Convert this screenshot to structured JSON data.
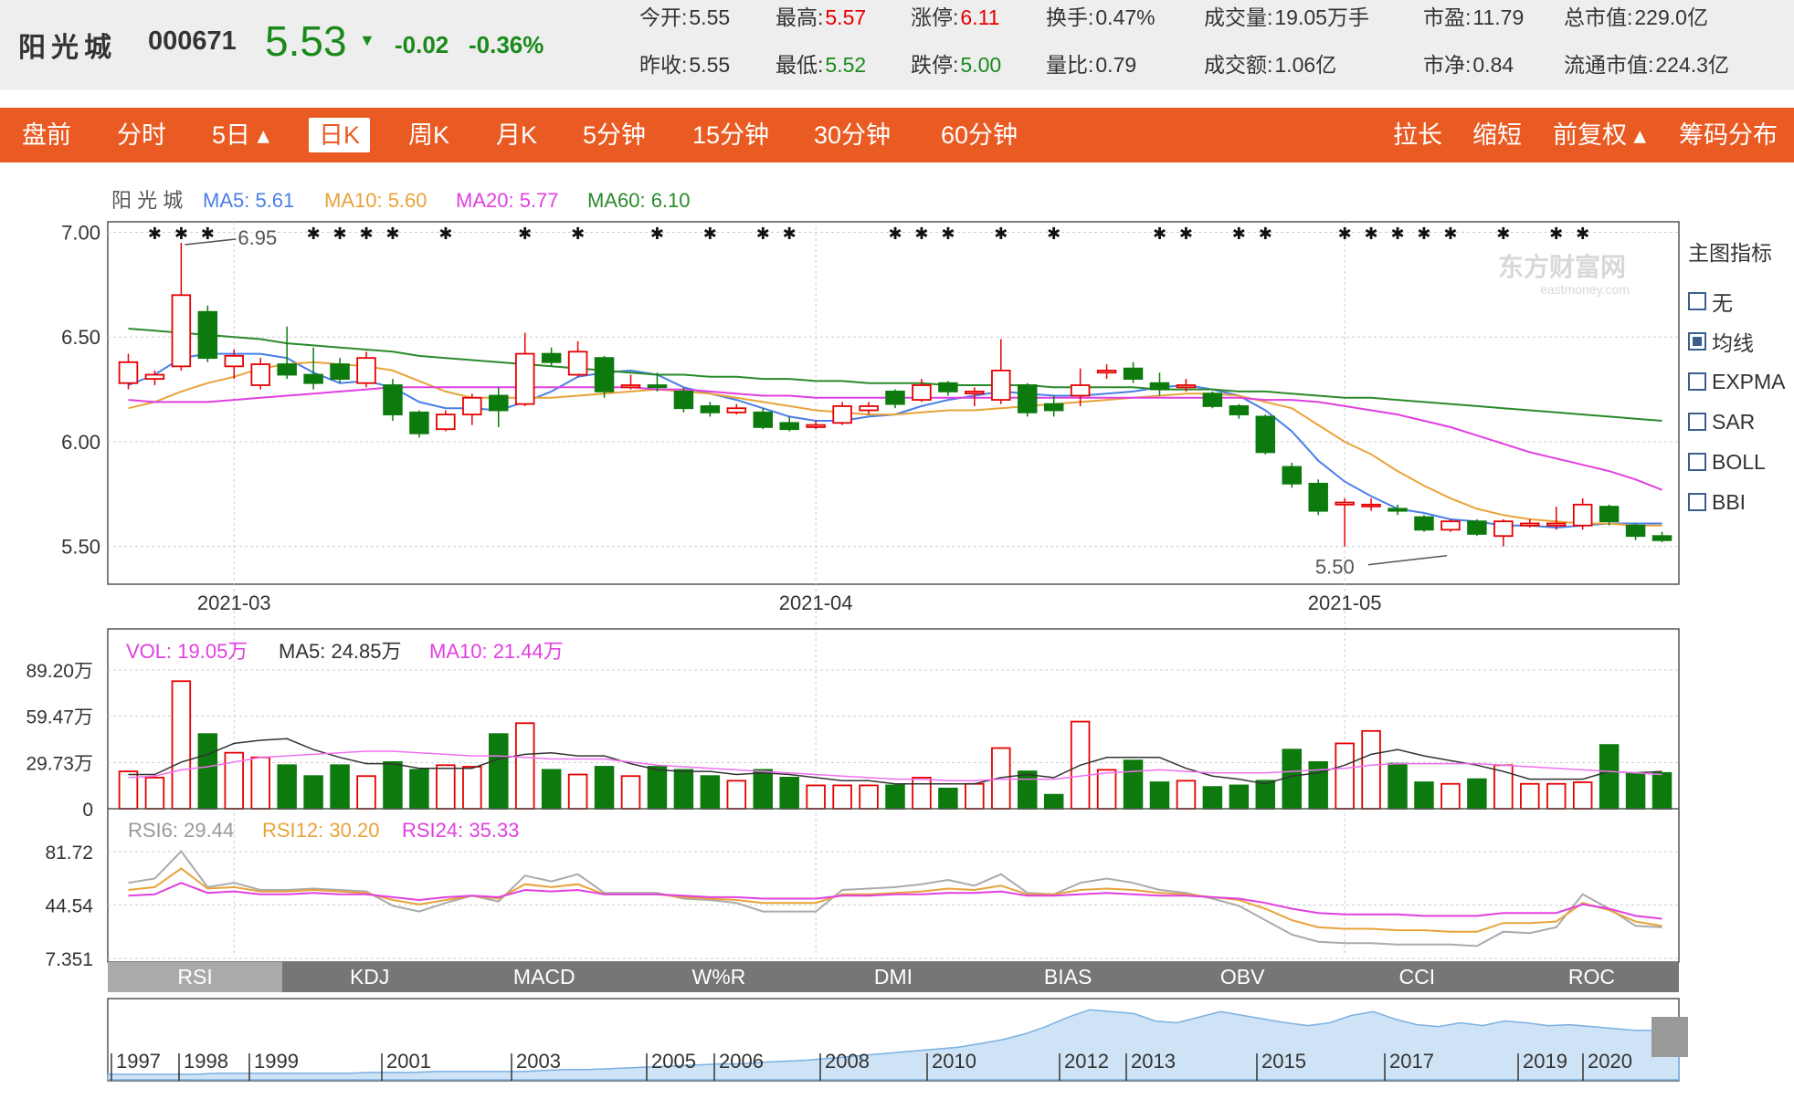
{
  "header": {
    "name": "阳光城",
    "code": "000671",
    "price": "5.53",
    "change": "-0.02",
    "change_pct": "-0.36%",
    "stats": [
      {
        "label": "今开:",
        "value": "5.55",
        "tone": "plain"
      },
      {
        "label": "最高:",
        "value": "5.57",
        "tone": "red"
      },
      {
        "label": "涨停:",
        "value": "6.11",
        "tone": "red"
      },
      {
        "label": "换手:",
        "value": "0.47%",
        "tone": "plain"
      },
      {
        "label": "成交量:",
        "value": "19.05万手",
        "tone": "plain"
      },
      {
        "label": "市盈:",
        "value": "11.79",
        "tone": "plain"
      },
      {
        "label": "总市值:",
        "value": "229.0亿",
        "tone": "plain"
      },
      {
        "label": "昨收:",
        "value": "5.55",
        "tone": "plain"
      },
      {
        "label": "最低:",
        "value": "5.52",
        "tone": "green"
      },
      {
        "label": "跌停:",
        "value": "5.00",
        "tone": "green"
      },
      {
        "label": "量比:",
        "value": "0.79",
        "tone": "plain"
      },
      {
        "label": "成交额:",
        "value": "1.06亿",
        "tone": "plain"
      },
      {
        "label": "市净:",
        "value": "0.84",
        "tone": "plain"
      },
      {
        "label": "流通市值:",
        "value": "224.3亿",
        "tone": "plain"
      }
    ]
  },
  "tabs": [
    {
      "id": "premarket",
      "label": "盘前"
    },
    {
      "id": "intraday",
      "label": "分时"
    },
    {
      "id": "5day",
      "label": "5日 ▴"
    },
    {
      "id": "daily",
      "label": "日K",
      "active": true
    },
    {
      "id": "weekly",
      "label": "周K"
    },
    {
      "id": "monthly",
      "label": "月K"
    },
    {
      "id": "5min",
      "label": "5分钟"
    },
    {
      "id": "15min",
      "label": "15分钟"
    },
    {
      "id": "30min",
      "label": "30分钟"
    },
    {
      "id": "60min",
      "label": "60分钟"
    },
    {
      "id": "stretch",
      "label": "拉长"
    },
    {
      "id": "shrink",
      "label": "缩短"
    },
    {
      "id": "adjust",
      "label": "前复权 ▴"
    },
    {
      "id": "chips",
      "label": "筹码分布"
    }
  ],
  "main_legend": [
    {
      "text": "阳 光 城",
      "color": "#555555"
    },
    {
      "text": "MA5: 5.61",
      "color": "#4a7ee8"
    },
    {
      "text": "MA10: 5.60",
      "color": "#e8a33a"
    },
    {
      "text": "MA20: 5.77",
      "color": "#e040e0"
    },
    {
      "text": "MA60: 6.10",
      "color": "#2a8a2a"
    }
  ],
  "indicator_panel": {
    "title": "主图指标",
    "items": [
      {
        "label": "无",
        "checked": false
      },
      {
        "label": "均线",
        "checked": true
      },
      {
        "label": "EXPMA",
        "checked": false
      },
      {
        "label": "SAR",
        "checked": false
      },
      {
        "label": "BOLL",
        "checked": false
      },
      {
        "label": "BBI",
        "checked": false
      }
    ]
  },
  "vol_legend": [
    {
      "text": "VOL: 19.05万",
      "color": "#e040e0"
    },
    {
      "text": "MA5: 24.85万",
      "color": "#333333"
    },
    {
      "text": "MA10: 21.44万",
      "color": "#e040e0"
    }
  ],
  "rsi_legend": [
    {
      "text": "RSI6: 29.44",
      "color": "#999999"
    },
    {
      "text": "RSI12: 30.20",
      "color": "#e8a33a"
    },
    {
      "text": "RSI24: 35.33",
      "color": "#e040e0"
    }
  ],
  "indicator_tabs": [
    "RSI",
    "KDJ",
    "MACD",
    "W%R",
    "DMI",
    "BIAS",
    "OBV",
    "CCI",
    "ROC"
  ],
  "watermark": {
    "text": "东方财富网",
    "sub": "eastmoney.com"
  },
  "overview_years": [
    "1997",
    "1998",
    "1999",
    "2001",
    "2003",
    "2005",
    "2006",
    "2008",
    "2010",
    "2012",
    "2013",
    "2015",
    "2017",
    "2019",
    "2020"
  ],
  "chart_data": {
    "type": "candlestick",
    "x_ticks": [
      "2021-03",
      "2021-04",
      "2021-05"
    ],
    "x_tick_index": [
      4,
      26,
      46
    ],
    "price_axis": {
      "ticks": [
        "7.00",
        "6.50",
        "6.00",
        "5.50"
      ],
      "values": [
        7.0,
        6.5,
        6.0,
        5.5
      ],
      "ylim": [
        5.32,
        7.05
      ]
    },
    "annotations": [
      {
        "text": "6.95",
        "index": 2,
        "value": 6.95
      },
      {
        "text": "5.50",
        "index": 50,
        "value": 5.5
      }
    ],
    "candles": [
      [
        6.28,
        6.38,
        6.42,
        6.25
      ],
      [
        6.3,
        6.32,
        6.34,
        6.27
      ],
      [
        6.36,
        6.7,
        6.95,
        6.34
      ],
      [
        6.62,
        6.4,
        6.65,
        6.38
      ],
      [
        6.36,
        6.41,
        6.44,
        6.3
      ],
      [
        6.27,
        6.37,
        6.4,
        6.25
      ],
      [
        6.37,
        6.32,
        6.55,
        6.3
      ],
      [
        6.32,
        6.28,
        6.45,
        6.25
      ],
      [
        6.37,
        6.3,
        6.4,
        6.28
      ],
      [
        6.28,
        6.4,
        6.43,
        6.26
      ],
      [
        6.27,
        6.13,
        6.3,
        6.1
      ],
      [
        6.14,
        6.04,
        6.15,
        6.02
      ],
      [
        6.06,
        6.13,
        6.15,
        6.05
      ],
      [
        6.13,
        6.21,
        6.23,
        6.08
      ],
      [
        6.22,
        6.15,
        6.26,
        6.07
      ],
      [
        6.18,
        6.42,
        6.52,
        6.17
      ],
      [
        6.42,
        6.38,
        6.45,
        6.36
      ],
      [
        6.32,
        6.43,
        6.48,
        6.31
      ],
      [
        6.4,
        6.24,
        6.41,
        6.21
      ],
      [
        6.26,
        6.27,
        6.32,
        6.25
      ],
      [
        6.27,
        6.26,
        6.33,
        6.24
      ],
      [
        6.24,
        6.16,
        6.26,
        6.14
      ],
      [
        6.17,
        6.14,
        6.19,
        6.12
      ],
      [
        6.14,
        6.16,
        6.18,
        6.13
      ],
      [
        6.14,
        6.07,
        6.16,
        6.06
      ],
      [
        6.09,
        6.06,
        6.12,
        6.05
      ],
      [
        6.07,
        6.08,
        6.1,
        6.06
      ],
      [
        6.09,
        6.17,
        6.19,
        6.08
      ],
      [
        6.15,
        6.17,
        6.19,
        6.13
      ],
      [
        6.24,
        6.18,
        6.25,
        6.16
      ],
      [
        6.2,
        6.27,
        6.3,
        6.19
      ],
      [
        6.28,
        6.24,
        6.29,
        6.22
      ],
      [
        6.23,
        6.24,
        6.26,
        6.17
      ],
      [
        6.2,
        6.34,
        6.49,
        6.18
      ],
      [
        6.27,
        6.14,
        6.28,
        6.12
      ],
      [
        6.18,
        6.15,
        6.22,
        6.12
      ],
      [
        6.22,
        6.27,
        6.35,
        6.17
      ],
      [
        6.33,
        6.34,
        6.37,
        6.3
      ],
      [
        6.35,
        6.3,
        6.38,
        6.28
      ],
      [
        6.28,
        6.25,
        6.33,
        6.22
      ],
      [
        6.26,
        6.27,
        6.3,
        6.24
      ],
      [
        6.23,
        6.17,
        6.24,
        6.16
      ],
      [
        6.17,
        6.13,
        6.18,
        6.11
      ],
      [
        6.12,
        5.95,
        6.13,
        5.94
      ],
      [
        5.88,
        5.8,
        5.9,
        5.78
      ],
      [
        5.8,
        5.67,
        5.82,
        5.65
      ],
      [
        5.7,
        5.71,
        5.73,
        5.5
      ],
      [
        5.7,
        5.7,
        5.73,
        5.67
      ],
      [
        5.68,
        5.67,
        5.7,
        5.65
      ],
      [
        5.64,
        5.58,
        5.65,
        5.57
      ],
      [
        5.58,
        5.62,
        5.63,
        5.57
      ],
      [
        5.62,
        5.56,
        5.63,
        5.55
      ],
      [
        5.55,
        5.62,
        5.63,
        5.5
      ],
      [
        5.6,
        5.61,
        5.63,
        5.59
      ],
      [
        5.6,
        5.61,
        5.69,
        5.58
      ],
      [
        5.6,
        5.7,
        5.73,
        5.58
      ],
      [
        5.69,
        5.62,
        5.7,
        5.6
      ],
      [
        5.6,
        5.55,
        5.61,
        5.53
      ],
      [
        5.55,
        5.53,
        5.57,
        5.52
      ]
    ],
    "ma": [
      {
        "name": "MA5",
        "color": "#4a7ee8",
        "values": [
          6.27,
          6.32,
          6.4,
          6.42,
          6.42,
          6.42,
          6.4,
          6.33,
          6.28,
          6.29,
          6.26,
          6.19,
          6.16,
          6.16,
          6.15,
          6.19,
          6.24,
          6.31,
          6.33,
          6.34,
          6.32,
          6.26,
          6.23,
          6.2,
          6.16,
          6.12,
          6.1,
          6.1,
          6.12,
          6.13,
          6.17,
          6.2,
          6.22,
          6.24,
          6.23,
          6.22,
          6.22,
          6.23,
          6.24,
          6.26,
          6.27,
          6.25,
          6.22,
          6.15,
          6.05,
          5.91,
          5.81,
          5.74,
          5.68,
          5.66,
          5.63,
          5.62,
          5.6,
          5.6,
          5.59,
          5.6,
          5.61,
          5.61,
          5.61
        ]
      },
      {
        "name": "MA10",
        "color": "#e8a33a",
        "values": [
          6.16,
          6.19,
          6.24,
          6.28,
          6.31,
          6.35,
          6.37,
          6.38,
          6.37,
          6.36,
          6.34,
          6.29,
          6.24,
          6.21,
          6.21,
          6.21,
          6.21,
          6.22,
          6.23,
          6.24,
          6.25,
          6.24,
          6.23,
          6.21,
          6.19,
          6.17,
          6.15,
          6.14,
          6.13,
          6.13,
          6.14,
          6.15,
          6.15,
          6.16,
          6.17,
          6.18,
          6.19,
          6.2,
          6.21,
          6.22,
          6.23,
          6.23,
          6.22,
          6.19,
          6.16,
          6.08,
          6.0,
          5.94,
          5.86,
          5.79,
          5.73,
          5.68,
          5.65,
          5.63,
          5.62,
          5.61,
          5.61,
          5.6,
          5.6
        ]
      },
      {
        "name": "MA20",
        "color": "#e040e0",
        "values": [
          6.2,
          6.19,
          6.19,
          6.19,
          6.2,
          6.21,
          6.22,
          6.23,
          6.24,
          6.25,
          6.26,
          6.26,
          6.26,
          6.26,
          6.26,
          6.26,
          6.26,
          6.26,
          6.26,
          6.26,
          6.25,
          6.25,
          6.24,
          6.23,
          6.22,
          6.22,
          6.21,
          6.21,
          6.21,
          6.21,
          6.21,
          6.21,
          6.21,
          6.21,
          6.21,
          6.21,
          6.21,
          6.21,
          6.21,
          6.21,
          6.21,
          6.21,
          6.21,
          6.2,
          6.2,
          6.19,
          6.17,
          6.15,
          6.13,
          6.1,
          6.07,
          6.03,
          5.99,
          5.95,
          5.92,
          5.89,
          5.86,
          5.82,
          5.77
        ]
      },
      {
        "name": "MA60",
        "color": "#2a8a2a",
        "values": [
          6.54,
          6.53,
          6.52,
          6.51,
          6.5,
          6.49,
          6.47,
          6.46,
          6.45,
          6.44,
          6.43,
          6.41,
          6.4,
          6.39,
          6.38,
          6.37,
          6.36,
          6.35,
          6.34,
          6.33,
          6.32,
          6.32,
          6.31,
          6.31,
          6.3,
          6.3,
          6.29,
          6.29,
          6.28,
          6.28,
          6.28,
          6.27,
          6.27,
          6.27,
          6.27,
          6.26,
          6.26,
          6.26,
          6.26,
          6.25,
          6.25,
          6.25,
          6.24,
          6.24,
          6.23,
          6.22,
          6.21,
          6.21,
          6.2,
          6.19,
          6.18,
          6.17,
          6.16,
          6.15,
          6.14,
          6.13,
          6.12,
          6.11,
          6.1
        ]
      }
    ],
    "volume": {
      "ticks": [
        "89.20万",
        "59.47万",
        "29.73万",
        "0"
      ],
      "values": [
        89.2,
        59.47,
        29.73,
        0
      ],
      "ylim": [
        0,
        89.2
      ],
      "bars": [
        24,
        20,
        82,
        48,
        36,
        33,
        28,
        21,
        28,
        21,
        30,
        25,
        28,
        27,
        48,
        55,
        25,
        22,
        27,
        21,
        27,
        25,
        21,
        18,
        25,
        20,
        15,
        15,
        15,
        15,
        20,
        13,
        16,
        39,
        24,
        9,
        56,
        25,
        31,
        17,
        18,
        14,
        15,
        18,
        38,
        30,
        42,
        50,
        29,
        17,
        16,
        19,
        28,
        16,
        16,
        17,
        41,
        23,
        23,
        19
      ],
      "ma5": [
        22,
        22,
        30,
        35,
        42,
        44,
        45,
        38,
        33,
        29,
        29,
        26,
        26,
        26,
        32,
        35,
        36,
        34,
        34,
        29,
        25,
        24,
        24,
        22,
        23,
        22,
        20,
        18,
        18,
        16,
        16,
        16,
        16,
        20,
        22,
        20,
        28,
        33,
        33,
        33,
        26,
        21,
        19,
        16,
        21,
        23,
        28,
        35,
        38,
        34,
        31,
        28,
        24,
        19,
        19,
        19,
        24,
        23,
        24,
        22
      ],
      "ma10": [
        20,
        21,
        25,
        27,
        30,
        33,
        34,
        35,
        36,
        37,
        37,
        36,
        35,
        34,
        34,
        33,
        32,
        32,
        32,
        30,
        28,
        27,
        26,
        25,
        24,
        23,
        22,
        21,
        20,
        19,
        19,
        18,
        18,
        19,
        19,
        19,
        21,
        23,
        24,
        25,
        24,
        23,
        23,
        23,
        24,
        25,
        26,
        28,
        29,
        29,
        29,
        29,
        28,
        27,
        26,
        25,
        24,
        23,
        22,
        21
      ]
    },
    "rsi": {
      "ticks": [
        "81.72",
        "44.54",
        "7.351"
      ],
      "values": [
        81.72,
        44.54,
        7.351
      ],
      "ylim": [
        7.351,
        81.72
      ],
      "rsi6": [
        60,
        63,
        82,
        57,
        60,
        55,
        55,
        56,
        55,
        54,
        44,
        40,
        46,
        51,
        47,
        65,
        61,
        66,
        53,
        53,
        53,
        49,
        48,
        46,
        40,
        40,
        40,
        55,
        56,
        57,
        59,
        62,
        58,
        66,
        53,
        52,
        60,
        63,
        60,
        55,
        53,
        49,
        44,
        34,
        24,
        19,
        18,
        18,
        17,
        17,
        17,
        16,
        26,
        25,
        29,
        52,
        42,
        30,
        29
      ],
      "rsi12": [
        55,
        57,
        70,
        56,
        57,
        54,
        54,
        55,
        54,
        53,
        48,
        45,
        48,
        51,
        49,
        59,
        57,
        59,
        52,
        52,
        52,
        50,
        49,
        48,
        46,
        46,
        46,
        52,
        52,
        53,
        54,
        56,
        55,
        58,
        52,
        52,
        55,
        56,
        55,
        53,
        52,
        50,
        48,
        42,
        34,
        29,
        28,
        28,
        27,
        27,
        26,
        26,
        32,
        32,
        33,
        46,
        41,
        33,
        30
      ],
      "rsi24": [
        51,
        52,
        60,
        53,
        54,
        52,
        52,
        53,
        52,
        52,
        50,
        48,
        50,
        51,
        50,
        55,
        54,
        55,
        52,
        52,
        52,
        51,
        50,
        50,
        49,
        49,
        49,
        51,
        51,
        52,
        52,
        53,
        53,
        54,
        51,
        51,
        52,
        53,
        52,
        51,
        51,
        50,
        49,
        46,
        42,
        39,
        38,
        38,
        38,
        37,
        37,
        37,
        39,
        39,
        39,
        45,
        42,
        37,
        35
      ]
    },
    "overview": {
      "series": [
        3,
        3,
        3,
        3,
        3,
        4,
        4,
        4,
        4,
        4,
        4,
        4,
        5,
        5,
        5,
        6,
        6,
        6,
        6,
        6,
        7,
        8,
        8,
        9,
        10,
        11,
        12,
        13,
        14,
        14,
        16,
        17,
        18,
        20,
        22,
        24,
        26,
        28,
        30,
        32,
        36,
        40,
        46,
        54,
        64,
        72,
        70,
        68,
        60,
        58,
        64,
        70,
        66,
        62,
        58,
        55,
        58,
        66,
        70,
        62,
        56,
        54,
        58,
        55,
        60,
        58,
        55,
        56,
        54,
        52,
        50,
        50,
        48
      ]
    }
  }
}
